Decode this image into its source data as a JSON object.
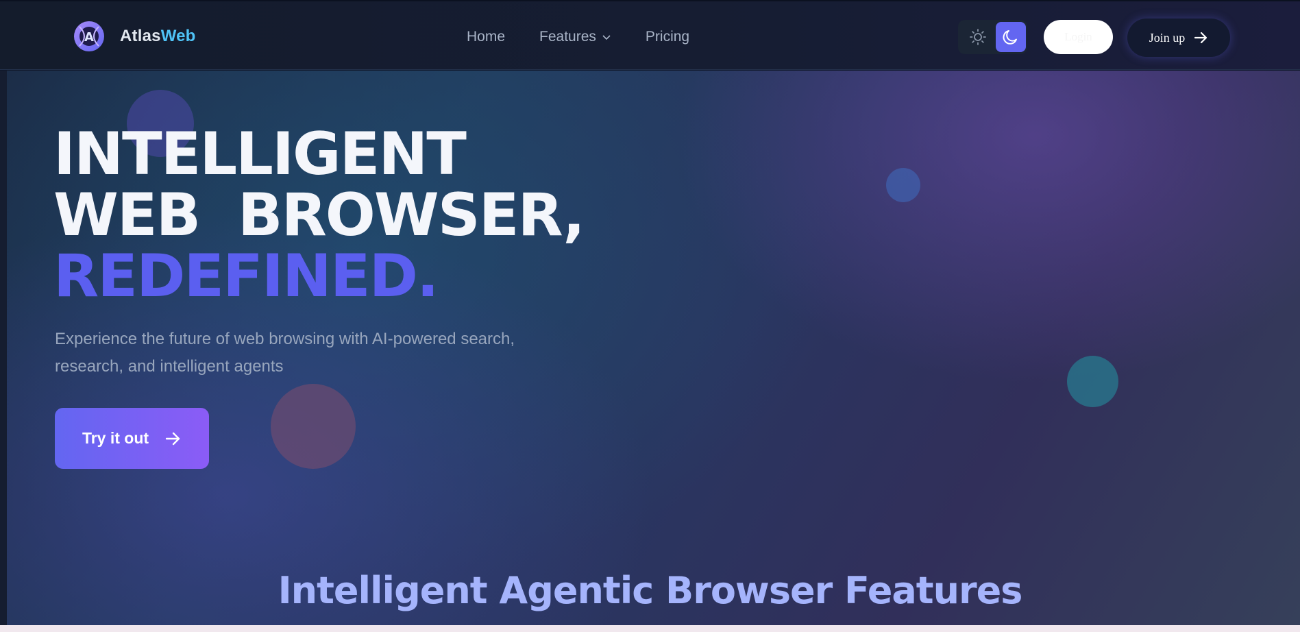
{
  "brand": {
    "name_part1": "Atlas",
    "name_part2": "Web",
    "logo_letter": "A"
  },
  "nav": {
    "items": [
      {
        "label": "Home"
      },
      {
        "label": "Features"
      },
      {
        "label": "Pricing"
      }
    ]
  },
  "header_actions": {
    "theme": "dark",
    "login_label": "Login",
    "join_label": "Join up"
  },
  "hero": {
    "headline_line1": "INTELLIGENT",
    "headline_line2": "WEB  BROWSER,",
    "headline_line3": "REDEFINED.",
    "subtitle": "Experience the future of web browsing with AI-powered search, research, and intelligent agents",
    "cta_label": "Try it out"
  },
  "features": {
    "title": "Intelligent Agentic Browser Features"
  },
  "colors": {
    "accent": "#6366f1",
    "accent_end": "#8b5cf6",
    "brand_blue": "#4fc3f7",
    "headline_accent": "#5b5ff0",
    "features_title": "#a5b4fc"
  }
}
